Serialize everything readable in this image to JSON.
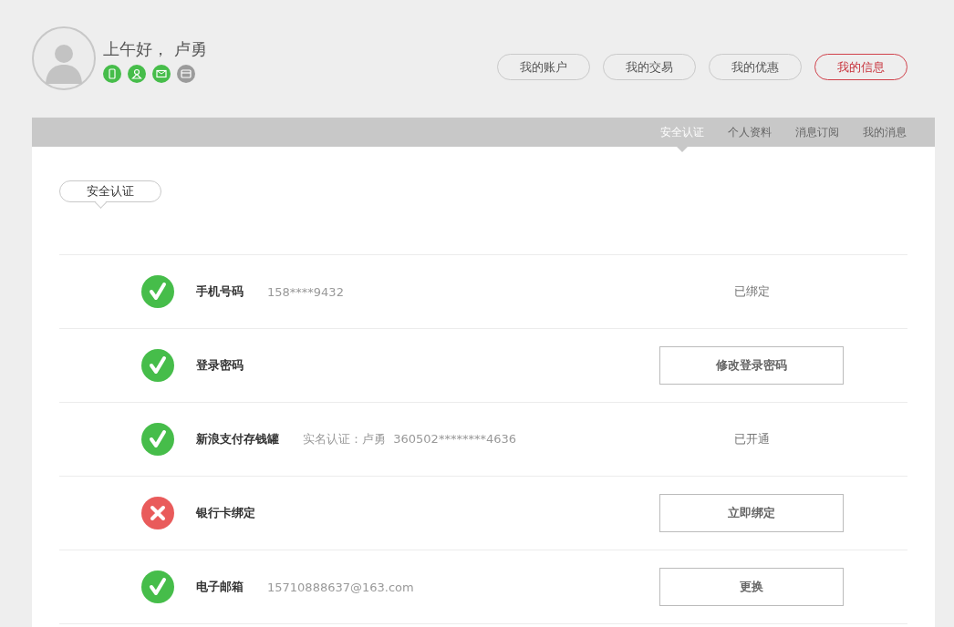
{
  "header": {
    "greeting": "上午好， 卢勇",
    "badges": [
      {
        "kind": "phone",
        "on": true
      },
      {
        "kind": "person",
        "on": true
      },
      {
        "kind": "mail",
        "on": true
      },
      {
        "kind": "card",
        "on": false
      }
    ],
    "nav": [
      {
        "label": "我的账户",
        "selected": false
      },
      {
        "label": "我的交易",
        "selected": false
      },
      {
        "label": "我的优惠",
        "selected": false
      },
      {
        "label": "我的信息",
        "selected": true
      }
    ]
  },
  "tabs": [
    {
      "label": "安全认证",
      "selected": true
    },
    {
      "label": "个人资料",
      "selected": false
    },
    {
      "label": "消息订阅",
      "selected": false
    },
    {
      "label": "我的消息",
      "selected": false
    }
  ],
  "section_title": "安全认证",
  "rows": [
    {
      "verified": true,
      "label": "手机号码",
      "detail": "158****9432",
      "action": {
        "kind": "status",
        "label": "已绑定"
      }
    },
    {
      "verified": true,
      "label": "登录密码",
      "action": {
        "kind": "button",
        "label": "修改登录密码"
      }
    },
    {
      "verified": true,
      "label": "新浪支付存钱罐",
      "detail": "实名认证：卢勇  360502********4636",
      "action": {
        "kind": "status",
        "label": "已开通"
      }
    },
    {
      "verified": false,
      "label": "银行卡绑定",
      "action": {
        "kind": "button",
        "label": "立即绑定"
      }
    },
    {
      "verified": true,
      "label": "电子邮箱",
      "detail": "15710888637@163.com",
      "action": {
        "kind": "button",
        "label": "更换"
      }
    }
  ]
}
